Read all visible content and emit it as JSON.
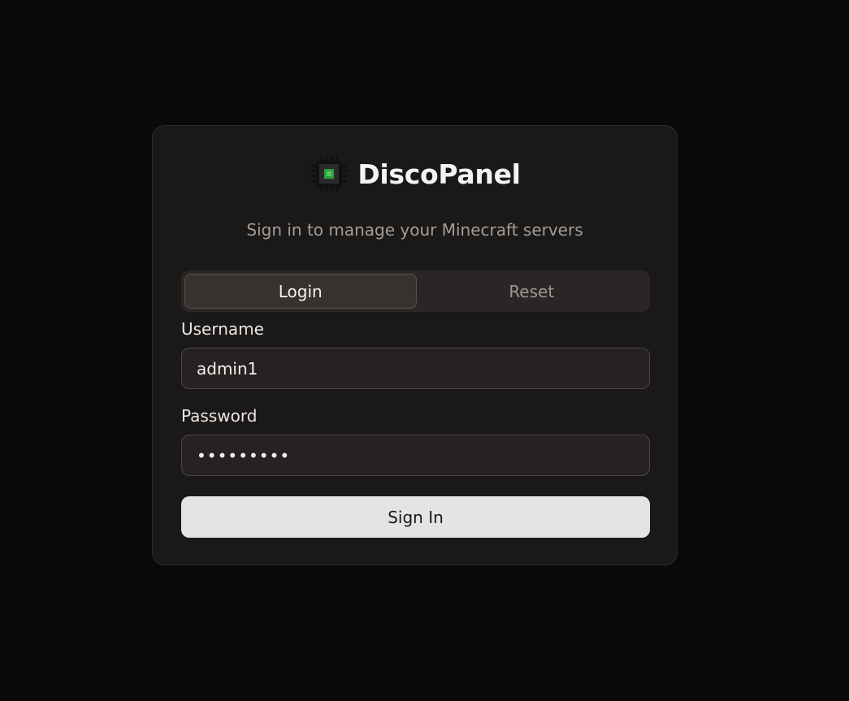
{
  "brand": {
    "name": "DiscoPanel",
    "logo_icon": "chip-icon",
    "accent_color": "#2e9e3e"
  },
  "subtitle": "Sign in to manage your Minecraft servers",
  "tabs": [
    {
      "label": "Login",
      "active": true
    },
    {
      "label": "Reset",
      "active": false
    }
  ],
  "form": {
    "username_label": "Username",
    "username_value": "admin1",
    "password_label": "Password",
    "password_value": "•••••••••",
    "submit_label": "Sign In"
  }
}
